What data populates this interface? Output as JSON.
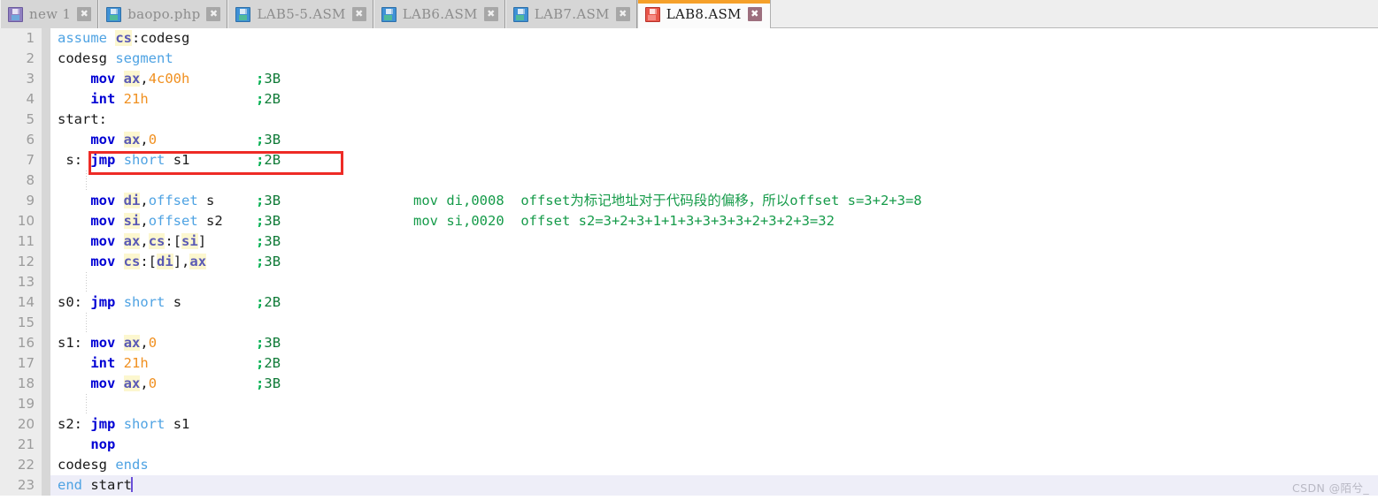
{
  "tabs": [
    {
      "label": "new 1",
      "icon": "floppy-disk-icon",
      "icon_color": "violet",
      "active": false,
      "close_label": "✖"
    },
    {
      "label": "baopo.php",
      "icon": "floppy-disk-icon",
      "icon_color": "blue",
      "active": false,
      "close_label": "✖"
    },
    {
      "label": "LAB5-5.ASM",
      "icon": "floppy-disk-icon",
      "icon_color": "blue",
      "active": false,
      "close_label": "✖"
    },
    {
      "label": "LAB6.ASM",
      "icon": "floppy-disk-icon",
      "icon_color": "blue",
      "active": false,
      "close_label": "✖"
    },
    {
      "label": "LAB7.ASM",
      "icon": "floppy-disk-icon",
      "icon_color": "blue",
      "active": false,
      "close_label": "✖"
    },
    {
      "label": "LAB8.ASM",
      "icon": "floppy-disk-icon",
      "icon_color": "red",
      "active": true,
      "close_label": "✖"
    }
  ],
  "editor": {
    "language": "assembly",
    "current_line": 23,
    "lines": [
      {
        "n": "1",
        "text": "assume cs:codesg"
      },
      {
        "n": "2",
        "text": "codesg segment"
      },
      {
        "n": "3",
        "text": "    mov ax,4c00h        ;3B"
      },
      {
        "n": "4",
        "text": "    int 21h             ;2B"
      },
      {
        "n": "5",
        "text": "start:"
      },
      {
        "n": "6",
        "text": "    mov ax,0            ;3B"
      },
      {
        "n": "7",
        "text": " s: jmp short s1        ;2B"
      },
      {
        "n": "8",
        "text": ""
      },
      {
        "n": "9",
        "text": "    mov di,offset s     ;3B"
      },
      {
        "n": "10",
        "text": "    mov si,offset s2    ;3B"
      },
      {
        "n": "11",
        "text": "    mov ax,cs:[si]      ;3B"
      },
      {
        "n": "12",
        "text": "    mov cs:[di],ax      ;3B"
      },
      {
        "n": "13",
        "text": ""
      },
      {
        "n": "14",
        "text": "s0: jmp short s         ;2B"
      },
      {
        "n": "15",
        "text": ""
      },
      {
        "n": "16",
        "text": "s1: mov ax,0            ;3B"
      },
      {
        "n": "17",
        "text": "    int 21h             ;2B"
      },
      {
        "n": "18",
        "text": "    mov ax,0            ;3B"
      },
      {
        "n": "19",
        "text": ""
      },
      {
        "n": "20",
        "text": "s2: jmp short s1"
      },
      {
        "n": "21",
        "text": "    nop"
      },
      {
        "n": "22",
        "text": "codesg ends"
      },
      {
        "n": "23",
        "text": "end start"
      }
    ],
    "annotations": [
      {
        "line": "9",
        "text": "mov di,0008  offset为标记地址对于代码段的偏移，所以offset s=3+2+3=8"
      },
      {
        "line": "10",
        "text": "mov si,0020  offset s2=3+2+3+1+1+3+3+3+3+2+3+2+3=32"
      }
    ]
  },
  "highlight_box": {
    "line": "7",
    "color": "#EE2B26"
  },
  "watermark": {
    "text": "CSDN @陌兮_"
  },
  "colors": {
    "keyword": "#0000D4",
    "directive": "#4FA3E3",
    "register": "#5A5AB5",
    "register_highlight": "#FCF7CF",
    "number": "#F09020",
    "comment": "#0F7A37",
    "annotation": "#169B4A",
    "active_tab_accent": "#F5A02A",
    "gutter_bg": "#ECECEC",
    "current_line_bg": "#EEEEF8"
  }
}
